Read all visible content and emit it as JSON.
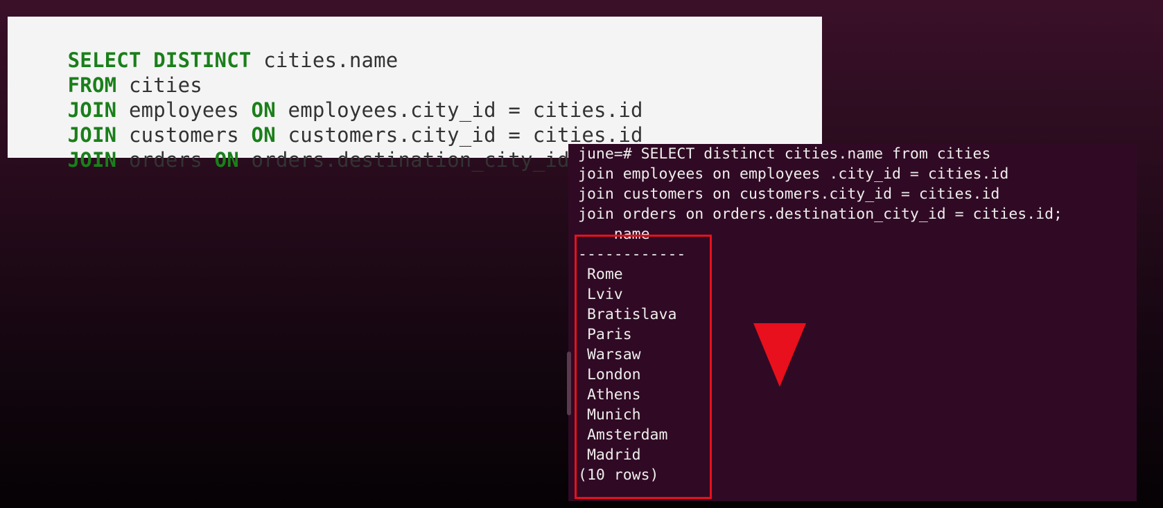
{
  "code": {
    "lines": [
      [
        {
          "t": "SELECT DISTINCT",
          "kw": true
        },
        {
          "t": " cities.name",
          "kw": false
        }
      ],
      [
        {
          "t": "FROM",
          "kw": true
        },
        {
          "t": " cities",
          "kw": false
        }
      ],
      [
        {
          "t": "JOIN",
          "kw": true
        },
        {
          "t": " employees ",
          "kw": false
        },
        {
          "t": "ON",
          "kw": true
        },
        {
          "t": " employees.city_id = cities.id",
          "kw": false
        }
      ],
      [
        {
          "t": "JOIN",
          "kw": true
        },
        {
          "t": " customers ",
          "kw": false
        },
        {
          "t": "ON",
          "kw": true
        },
        {
          "t": " customers.city_id = cities.id",
          "kw": false
        }
      ],
      [
        {
          "t": "JOIN",
          "kw": true
        },
        {
          "t": " orders ",
          "kw": false
        },
        {
          "t": "ON",
          "kw": true
        },
        {
          "t": " orders.destination_city_id = cities.id;",
          "kw": false
        }
      ]
    ]
  },
  "terminal": {
    "query_lines": [
      "june=# SELECT distinct cities.name from cities",
      "join employees on employees .city_id = cities.id",
      "join customers on customers.city_id = cities.id",
      "join orders on orders.destination_city_id = cities.id;"
    ],
    "column_header": "    name",
    "separator": "------------",
    "rows": [
      " Rome",
      " Lviv",
      " Bratislava",
      " Paris",
      " Warsaw",
      " London",
      " Athens",
      " Munich",
      " Amsterdam",
      " Madrid"
    ],
    "row_count": "(10 rows)"
  },
  "colors": {
    "keyword": "#1a7f1a",
    "code_text": "#333333",
    "code_background": "#f4f4f4",
    "terminal_background": "#300a24",
    "terminal_text": "#eeeeec",
    "highlight": "#e8101c",
    "arrow": "#e8101c"
  },
  "icons": {
    "arrow": "down-triangle-arrow-icon"
  }
}
